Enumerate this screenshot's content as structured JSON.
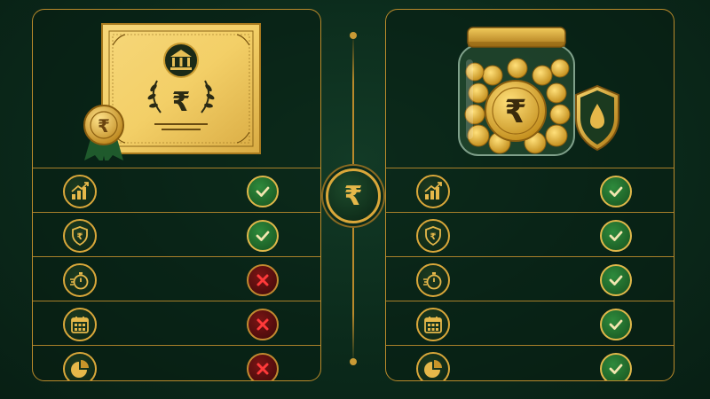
{
  "colors": {
    "background": "#0b2a1b",
    "gold": "#d9a73a",
    "check": "#2e8a3c",
    "cross": "#c0202a"
  },
  "center": {
    "icon": "rupee-icon",
    "symbol": "₹"
  },
  "left_panel": {
    "hero_icon": "rupee-certificate-icon",
    "certificate_symbol": "₹",
    "medal_symbol": "₹",
    "rows": [
      {
        "feature_icon": "growth-chart-icon",
        "status": "check"
      },
      {
        "feature_icon": "rupee-shield-icon",
        "status": "check"
      },
      {
        "feature_icon": "stopwatch-icon",
        "status": "cross"
      },
      {
        "feature_icon": "calendar-icon",
        "status": "cross"
      },
      {
        "feature_icon": "pie-chart-icon",
        "status": "cross"
      }
    ]
  },
  "right_panel": {
    "hero_icon": "rupee-coin-jar-icon",
    "jar_symbol": "₹",
    "rows": [
      {
        "feature_icon": "growth-chart-icon",
        "status": "check"
      },
      {
        "feature_icon": "rupee-shield-icon",
        "status": "check"
      },
      {
        "feature_icon": "stopwatch-icon",
        "status": "check"
      },
      {
        "feature_icon": "calendar-icon",
        "status": "check"
      },
      {
        "feature_icon": "pie-chart-icon",
        "status": "check"
      }
    ]
  }
}
